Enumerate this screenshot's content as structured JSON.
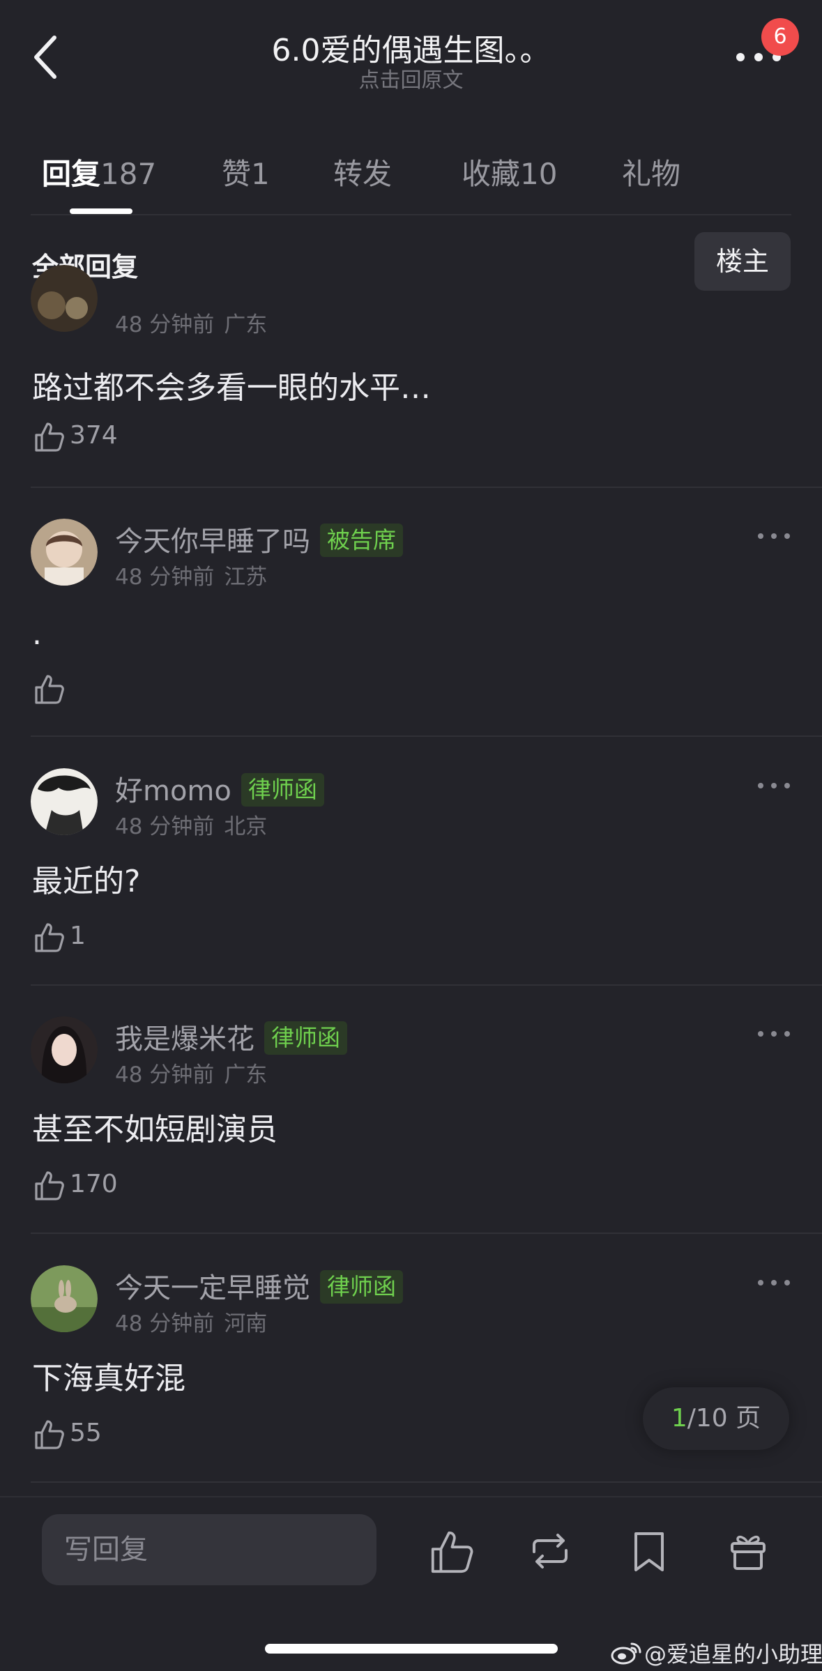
{
  "header": {
    "title": "6.0爱的偶遇生图。。",
    "subtitle": "点击回原文",
    "badge_count": "6"
  },
  "tabs": [
    {
      "label": "回复",
      "count": "187",
      "active": true
    },
    {
      "label": "赞",
      "count": "1"
    },
    {
      "label": "转发",
      "count": ""
    },
    {
      "label": "收藏",
      "count": "10"
    },
    {
      "label": "礼物",
      "count": ""
    }
  ],
  "section": {
    "title": "全部回复",
    "op_button": "楼主"
  },
  "comments": [
    {
      "name": "",
      "tag": "",
      "time": "48 分钟前",
      "location": "广东",
      "text": "路过都不会多看一眼的水平…",
      "likes": "374"
    },
    {
      "name": "今天你早睡了吗",
      "tag": "被告席",
      "time": "48 分钟前",
      "location": "江苏",
      "text": ".",
      "likes": ""
    },
    {
      "name": "好momo",
      "tag": "律师函",
      "time": "48 分钟前",
      "location": "北京",
      "text": "最近的?",
      "likes": "1"
    },
    {
      "name": "我是爆米花",
      "tag": "律师函",
      "time": "48 分钟前",
      "location": "广东",
      "text": "甚至不如短剧演员",
      "likes": "170"
    },
    {
      "name": "今天一定早睡觉",
      "tag": "律师函",
      "time": "48 分钟前",
      "location": "河南",
      "text": "下海真好混",
      "likes": "55"
    }
  ],
  "pagination": {
    "current": "1",
    "total": "/10 页"
  },
  "bottom_bar": {
    "reply_placeholder": "写回复"
  },
  "watermark": "@爱追星的小助理",
  "colors": {
    "background": "#232329",
    "accent_green": "#6fd04e",
    "badge_red": "#f14c4c"
  },
  "icons": [
    "back-arrow-icon",
    "more-icon",
    "thumbs-up-icon",
    "repost-icon",
    "bookmark-icon",
    "gift-icon",
    "weibo-logo-icon"
  ]
}
